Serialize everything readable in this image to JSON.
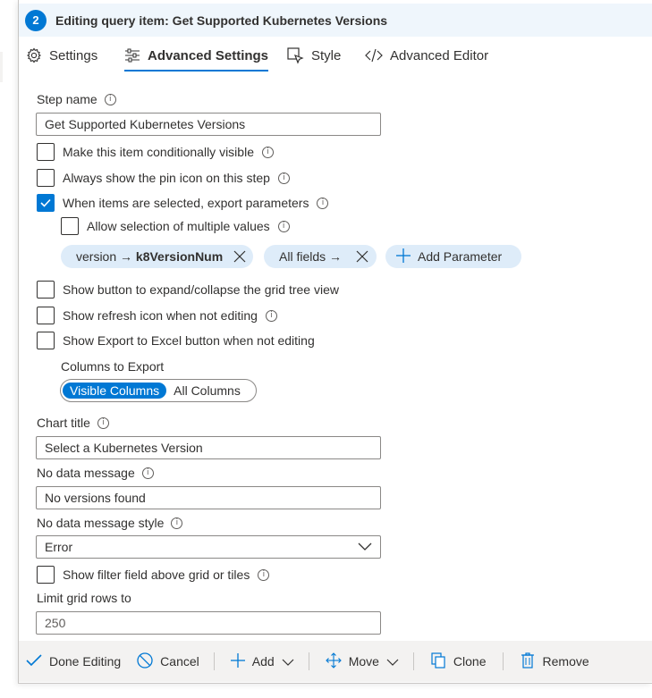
{
  "header": {
    "step_number": "2",
    "title": "Editing query item: Get Supported Kubernetes Versions"
  },
  "tabs": [
    {
      "label": "Settings",
      "icon": "gear-icon"
    },
    {
      "label": "Advanced Settings",
      "icon": "sliders-icon",
      "active": true
    },
    {
      "label": "Style",
      "icon": "style-icon"
    },
    {
      "label": "Advanced Editor",
      "icon": "code-icon"
    }
  ],
  "form": {
    "step_name_label": "Step name",
    "step_name_value": "Get Supported Kubernetes Versions",
    "checkbox_conditional": "Make this item conditionally visible",
    "checkbox_pin": "Always show the pin icon on this step",
    "checkbox_export": "When items are selected, export parameters",
    "checkbox_multi": "Allow selection of multiple values",
    "param_pill_1_from": "version →",
    "param_pill_1_to": "k8VersionNum",
    "param_pill_2": "All fields →",
    "add_parameter": "Add Parameter",
    "checkbox_expand": "Show button to expand/collapse the grid tree view",
    "checkbox_refresh": "Show refresh icon when not editing",
    "checkbox_excel": "Show Export to Excel button when not editing",
    "columns_to_export_label": "Columns to Export",
    "columns_visible": "Visible Columns",
    "columns_all": "All Columns",
    "chart_title_label": "Chart title",
    "chart_title_value": "Select a Kubernetes Version",
    "no_data_label": "No data message",
    "no_data_value": "No versions found",
    "no_data_style_label": "No data message style",
    "no_data_style_value": "Error",
    "checkbox_filter": "Show filter field above grid or tiles",
    "limit_rows_label": "Limit grid rows to",
    "limit_rows_value": "250"
  },
  "footer": {
    "done": "Done Editing",
    "cancel": "Cancel",
    "add": "Add",
    "move": "Move",
    "clone": "Clone",
    "remove": "Remove"
  },
  "colors": {
    "accent": "#0078d4",
    "header_bg": "#eff6fc",
    "pill_bg": "#deecf9",
    "footer_bg": "#f3f2f1"
  }
}
